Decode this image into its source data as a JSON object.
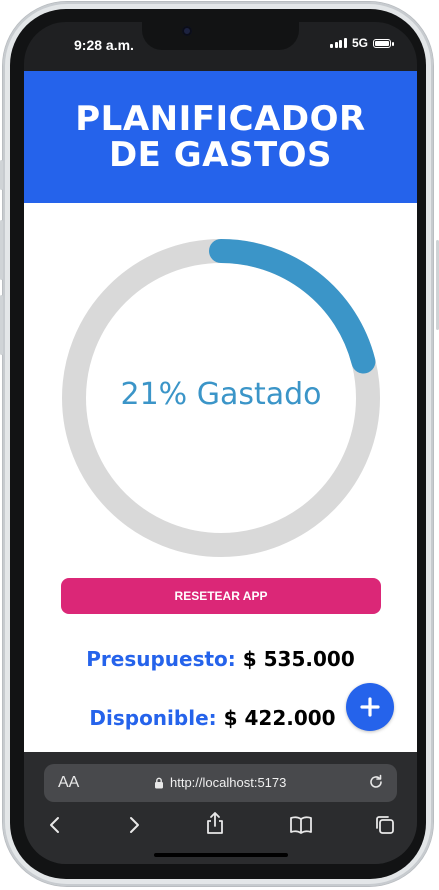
{
  "status_bar": {
    "time": "9:28 a.m.",
    "network": "5G"
  },
  "header": {
    "title": "PLANIFICADOR DE GASTOS"
  },
  "progress": {
    "percent": 21,
    "label": "21% Gastado"
  },
  "actions": {
    "reset_label": "RESETEAR APP",
    "add_icon": "plus-icon"
  },
  "summary": {
    "budget_label": "Presupuesto:",
    "budget_value": "$ 535.000",
    "available_label": "Disponible:",
    "available_value": "$ 422.000"
  },
  "browser": {
    "text_size_label": "AA",
    "url": "http://localhost:5173",
    "icons": [
      "lock-icon",
      "reload-icon",
      "back-icon",
      "forward-icon",
      "share-icon",
      "bookmarks-icon",
      "tabs-icon"
    ]
  },
  "colors": {
    "header_bg": "#2563eb",
    "progress": "#3b95c8",
    "track": "#d9d9d9",
    "reset_button": "#db2777",
    "labels": "#2563eb"
  }
}
